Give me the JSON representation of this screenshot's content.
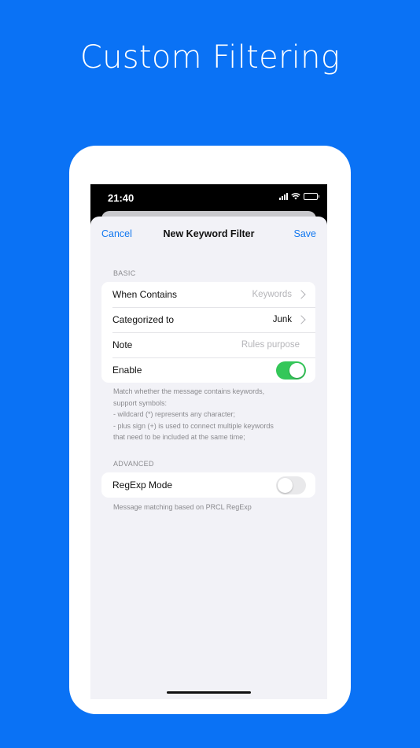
{
  "headline": "Custom Filtering",
  "status_bar": {
    "time": "21:40",
    "icons": [
      "cellular-signal-icon",
      "wifi-icon",
      "battery-charging-icon"
    ]
  },
  "nav": {
    "cancel": "Cancel",
    "title": "New Keyword Filter",
    "save": "Save"
  },
  "basic": {
    "header": "BASIC",
    "rows": [
      {
        "label": "When Contains",
        "value": "Keywords",
        "placeholder": true,
        "chevron": true
      },
      {
        "label": "Categorized to",
        "value": "Junk",
        "placeholder": false,
        "chevron": true
      },
      {
        "label": "Note",
        "value": "Rules purpose",
        "placeholder": true,
        "chevron": false
      },
      {
        "label": "Enable",
        "toggle": true
      }
    ],
    "footer": [
      "Match whether the message contains keywords,",
      "support symbols:",
      "- wildcard (*) represents any character;",
      "- plus sign (+) is used to connect multiple keywords",
      "that need to be included at the same time;"
    ]
  },
  "advanced": {
    "header": "ADVANCED",
    "row": {
      "label": "RegExp Mode",
      "toggle": false
    },
    "footer": "Message matching based on PRCL RegExp"
  },
  "colors": {
    "background": "#0a72f5",
    "accent": "#1378f0",
    "toggle_on": "#34c759",
    "sheet_bg": "#f2f2f7"
  }
}
